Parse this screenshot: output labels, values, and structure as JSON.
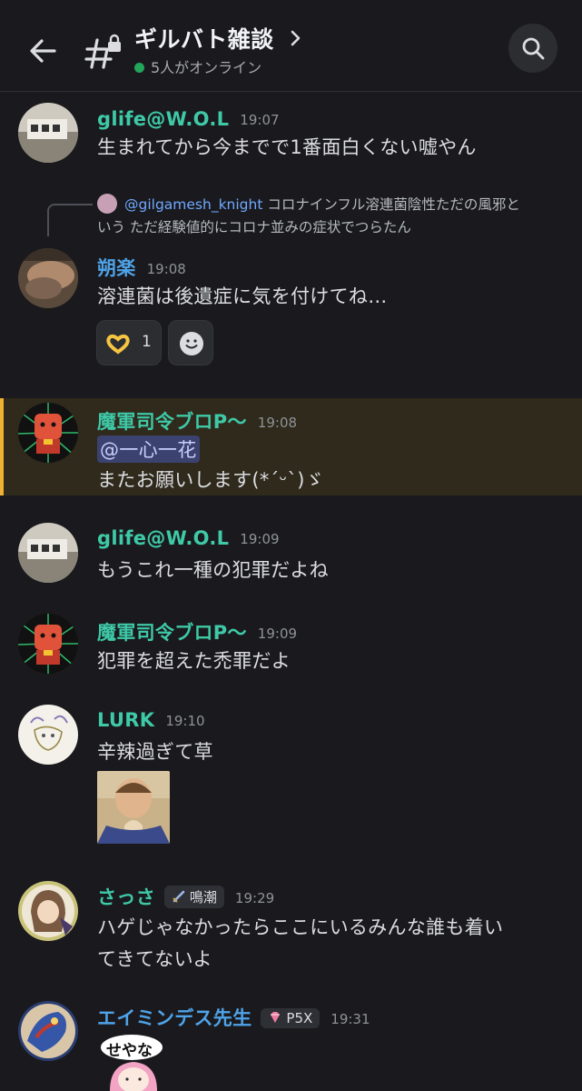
{
  "header": {
    "channel_name": "ギルバト雑談",
    "online_text": "5人がオンライン"
  },
  "colors": {
    "background": "#1a1a1e",
    "online": "#23a55a",
    "highlight_border": "#f0b232",
    "name_teal": "#3ec9a7",
    "name_blue": "#4fa3e8"
  },
  "messages": [
    {
      "author": "glife@W.O.L",
      "time": "19:07",
      "text": "生まれてから今までで1番面白くない嘘やん"
    },
    {
      "reply": {
        "mention": "@gilgamesh_knight",
        "line1": "コロナインフル溶連菌陰性ただの風邪と",
        "line2": "いう ただ経験値的にコロナ並みの症状でつらたん"
      },
      "author": "朔楽",
      "time": "19:08",
      "text": "溶連菌は後遺症に気を付けてね…",
      "reaction_count": "1"
    },
    {
      "author": "魔軍司令ブロP～",
      "time": "19:08",
      "mention": "@一心一花",
      "text": "またお願いします(*ˊᵕˋ)ゞ"
    },
    {
      "author": "glife@W.O.L",
      "time": "19:09",
      "text": "もうこれ一種の犯罪だよね"
    },
    {
      "author": "魔軍司令ブロP～",
      "time": "19:09",
      "text": "犯罪を超えた禿罪だよ"
    },
    {
      "author": "LURK",
      "time": "19:10",
      "text": "辛辣過ぎて草"
    },
    {
      "author": "さっさ",
      "badge": "鳴潮",
      "time": "19:29",
      "line1": "ハゲじゃなかったらここにいるみんな誰も着い",
      "line2": "てきてないよ"
    },
    {
      "author": "エイミンデス先生",
      "badge": "P5X",
      "time": "19:31",
      "sticker_text": "せやな"
    }
  ]
}
